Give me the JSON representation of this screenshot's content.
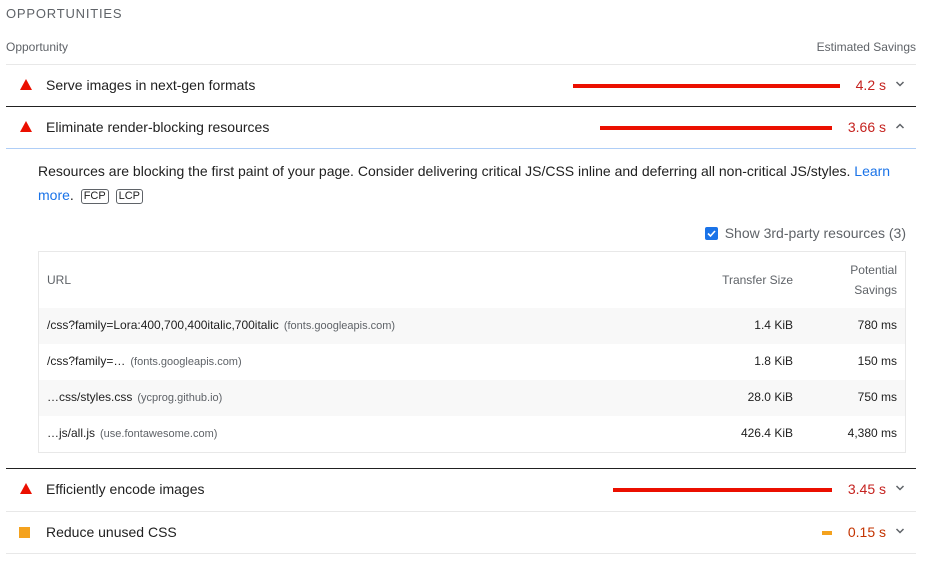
{
  "section_title": "OPPORTUNITIES",
  "columns": {
    "opportunity": "Opportunity",
    "savings": "Estimated Savings"
  },
  "audits": [
    {
      "title": "Serve images in next-gen formats",
      "value": "4.2 s",
      "severity": "fail",
      "bar_fraction": 1.0,
      "expanded": false
    },
    {
      "title": "Eliminate render-blocking resources",
      "value": "3.66 s",
      "severity": "fail",
      "bar_fraction": 0.87,
      "expanded": true
    },
    {
      "title": "Efficiently encode images",
      "value": "3.45 s",
      "severity": "fail",
      "bar_fraction": 0.82,
      "expanded": false
    },
    {
      "title": "Reduce unused CSS",
      "value": "0.15 s",
      "severity": "average",
      "bar_fraction": 0.036,
      "expanded": false
    }
  ],
  "expanded": {
    "description": "Resources are blocking the first paint of your page. Consider delivering critical JS/CSS inline and deferring all non-critical JS/styles.",
    "learn_more": "Learn more",
    "learn_more_tail": ".",
    "tags": [
      "FCP",
      "LCP"
    ],
    "third_party_label": "Show 3rd-party resources (3)",
    "third_party_checked": true,
    "table": {
      "headers": {
        "url": "URL",
        "transfer": "Transfer Size",
        "savings_line1": "Potential",
        "savings_line2": "Savings"
      },
      "rows": [
        {
          "url": "/css?family=Lora:400,700,400italic,700italic",
          "host": "(fonts.googleapis.com)",
          "size": "1.4 KiB",
          "savings": "780 ms"
        },
        {
          "url": "/css?family=…",
          "host": "(fonts.googleapis.com)",
          "size": "1.8 KiB",
          "savings": "150 ms"
        },
        {
          "url": "…css/styles.css",
          "host": "(ycprog.github.io)",
          "size": "28.0 KiB",
          "savings": "750 ms"
        },
        {
          "url": "…js/all.js",
          "host": "(use.fontawesome.com)",
          "size": "426.4 KiB",
          "savings": "4,380 ms"
        }
      ]
    }
  },
  "colors": {
    "fail": "#eb0f00",
    "average": "#f4a21e",
    "link": "#1a73e8"
  },
  "icons": {
    "fail": "red-triangle-icon",
    "average": "orange-square-icon",
    "chevron": "chevron-icon",
    "checkbox": "checkmark-icon"
  }
}
